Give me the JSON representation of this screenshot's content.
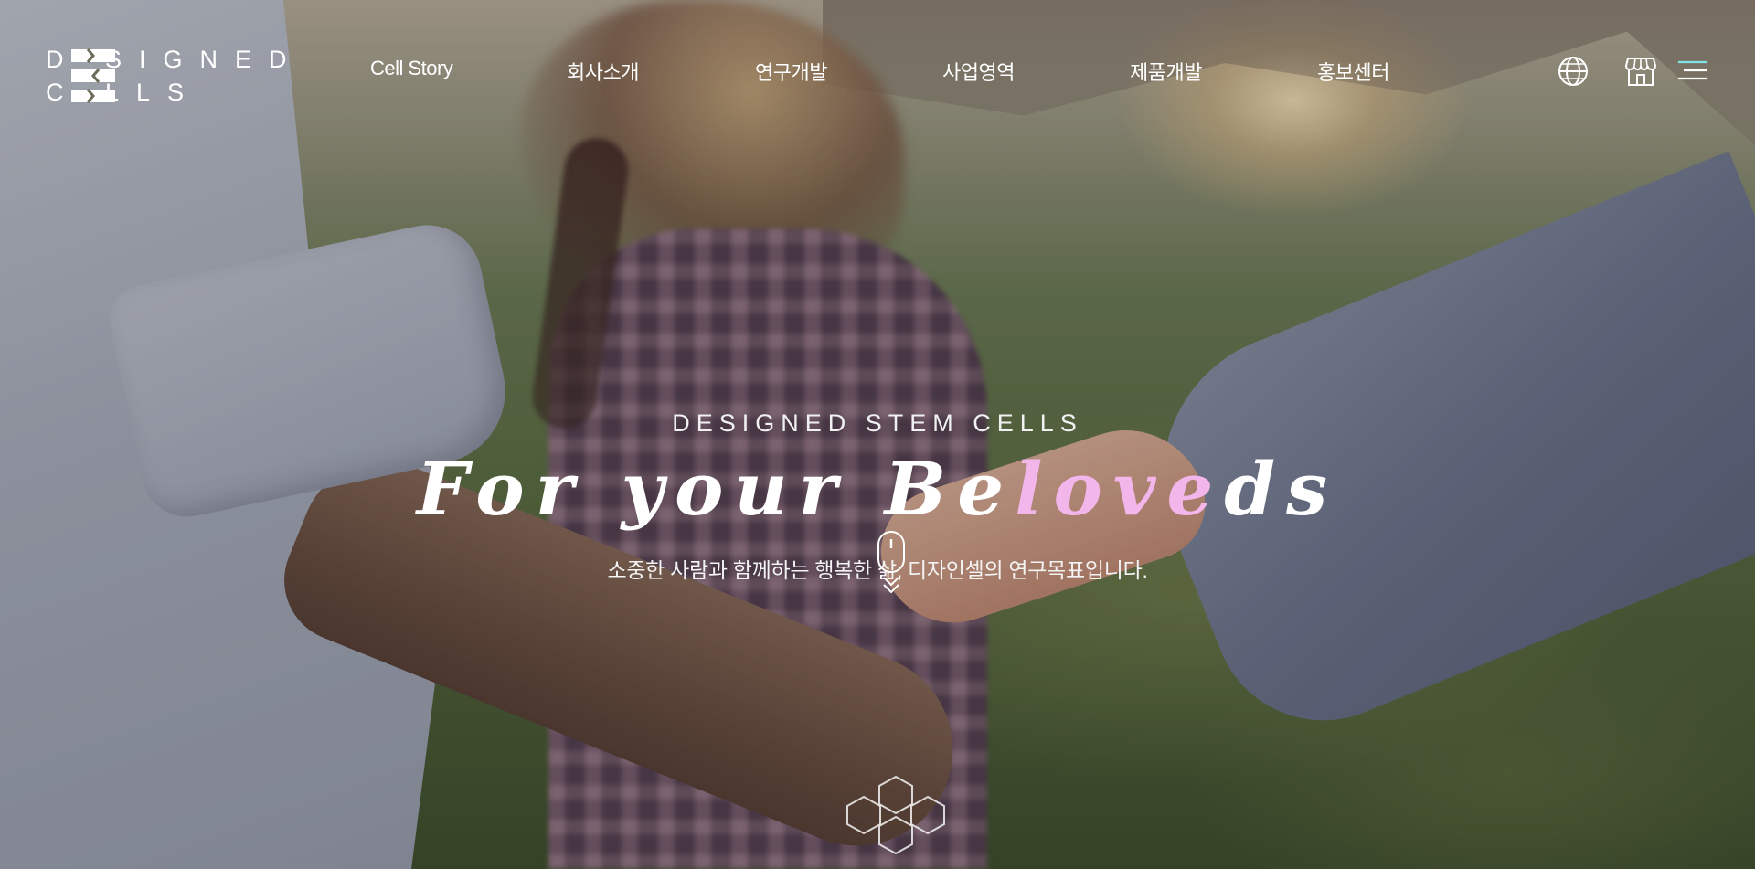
{
  "brand": {
    "logo_line1": "D SIGNED",
    "logo_line2": "C LLS",
    "name": "DESIGNED CELLS"
  },
  "nav": {
    "items": [
      {
        "label": "Cell Story"
      },
      {
        "label": "회사소개"
      },
      {
        "label": "연구개발"
      },
      {
        "label": "사업영역"
      },
      {
        "label": "제품개발"
      },
      {
        "label": "홍보센터"
      }
    ]
  },
  "header_icons": {
    "language": "globe-icon",
    "shop": "store-icon",
    "menu": "hamburger-menu-icon"
  },
  "hero": {
    "eyebrow": "DESIGNED STEM CELLS",
    "headline_part1": "For your Be",
    "headline_highlight": "love",
    "headline_part2": "ds",
    "subtitle": "소중한 사람과 함께하는 행복한 삶, 디자인셀의 연구목표입니다."
  },
  "colors": {
    "accent_pink": "#f3b6ea",
    "text": "#ffffff"
  },
  "decor": {
    "scroll": "mouse-scroll-icon",
    "hexagons": "hexagon-cluster-icon"
  }
}
